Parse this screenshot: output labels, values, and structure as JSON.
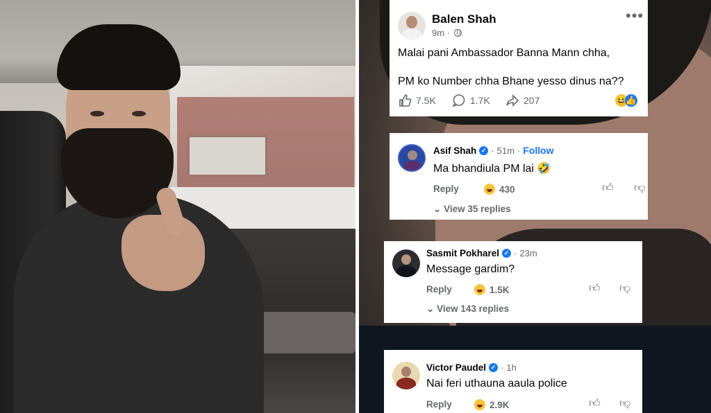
{
  "post": {
    "author": "Balen Shah",
    "time": "9m",
    "line1": "Malai pani Ambassador Banna Mann chha,",
    "line2": "PM ko Number chha Bhane yesso dinus na??",
    "likes": "7.5K",
    "comments": "1.7K",
    "shares": "207",
    "more": "•••"
  },
  "comments": [
    {
      "name": "Asif Shah",
      "time": "51m",
      "follow": "Follow",
      "text": "Ma bhandiula PM lai 🤣",
      "reply": "Reply",
      "reactions": "430",
      "view_replies": "View 35 replies"
    },
    {
      "name": "Sasmit Pokharel",
      "time": "23m",
      "text": "Message gardim?",
      "reply": "Reply",
      "reactions": "1.5K",
      "view_replies": "View 143 replies"
    },
    {
      "name": "Victor Paudel",
      "time": "1h",
      "text": "Nai feri uthauna aaula police",
      "reply": "Reply",
      "reactions": "2.9K"
    }
  ],
  "colors": {
    "link": "#1877f2",
    "secondary_text": "#65676b",
    "verified": "#1877f2",
    "haha": "#f7c33b"
  }
}
